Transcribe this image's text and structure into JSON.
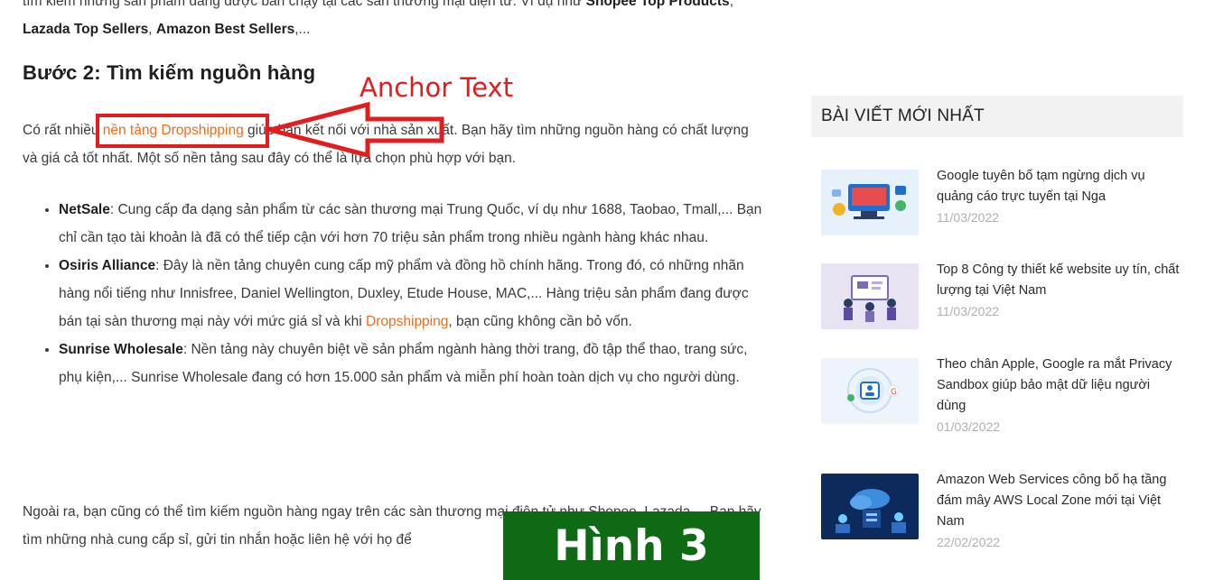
{
  "article": {
    "intro_cut": {
      "text_before": "tìm kiếm những sản phẩm đang được bán chạy tại các sàn thương mại điện tử. Ví dụ như ",
      "bold1": "Shopee Top Products",
      "sep1": ", ",
      "bold2": "Lazada Top Sellers",
      "sep2": ", ",
      "bold3": "Amazon Best Sellers",
      "tail": ",..."
    },
    "heading": "Bước 2: Tìm kiếm nguồn hàng",
    "para1": {
      "before": "Có rất nhiều ",
      "link": "nền tảng Dropshipping",
      "after": " giúp bạn kết nối với nhà sản xuất. Bạn hãy tìm những nguồn hàng có chất lượng và giá cả tốt nhất. Một số nền tảng sau đây có thể là lựa chọn phù hợp với bạn."
    },
    "bullets": [
      {
        "bold": "NetSale",
        "text": ": Cung cấp đa dạng sản phẩm từ các sàn thương mại Trung Quốc, ví dụ như 1688, Taobao, Tmall,... Bạn chỉ cần tạo tài khoản là đã có thể tiếp cận với hơn 70 triệu sản phẩm trong nhiều ngành hàng khác nhau."
      },
      {
        "bold": "Osiris Alliance",
        "text": ": Đây là nền tảng chuyên cung cấp mỹ phẩm và đồng hồ chính hãng. Trong đó, có những nhãn hàng nổi tiếng như Innisfree, Daniel Wellington, Duxley, Etude House, MAC,... Hàng triệu sản phẩm đang được bán tại sàn thương mại này với mức giá sỉ và khi ",
        "link": "Dropshipping",
        "tail": ", bạn cũng không cần bỏ vốn."
      },
      {
        "bold": "Sunrise Wholesale",
        "text": ": Nền tảng này chuyên biệt về sản phẩm ngành hàng thời trang, đồ tập thể thao, trang sức, phụ kiện,... Sunrise Wholesale đang có hơn 15.000 sản phẩm và miễn phí hoàn toàn dịch vụ cho người dùng."
      }
    ],
    "para2": "Ngoài ra, bạn cũng có thể tìm kiếm nguồn hàng ngay trên các sàn thương mại điện tử như Shopee, Lazada,... Bạn hãy tìm những nhà cung cấp sỉ, gửi tin nhắn hoặc liên hệ với họ để"
  },
  "annotation": {
    "anchor_label": "Anchor Text",
    "figure_label": "Hình 3"
  },
  "sidebar": {
    "title": "BÀI VIẾT MỚI NHẤT",
    "posts": [
      {
        "title": "Google tuyên bố tạm ngừng dịch vụ quảng cáo trực tuyến tại Nga",
        "date": "11/03/2022"
      },
      {
        "title": "Top 8 Công ty thiết kế website uy tín, chất lượng tại Việt Nam",
        "date": "11/03/2022"
      },
      {
        "title": "Theo chân Apple, Google ra mắt Privacy Sandbox giúp bảo mật dữ liệu người dùng",
        "date": "01/03/2022"
      },
      {
        "title": "Amazon Web Services công bố hạ tầng đám mây AWS Local Zone mới tại Việt Nam",
        "date": "22/02/2022"
      }
    ]
  },
  "colors": {
    "link": "#ef6c1a",
    "annotation_red": "#e31d1d",
    "figure_green": "#0e6b14"
  }
}
